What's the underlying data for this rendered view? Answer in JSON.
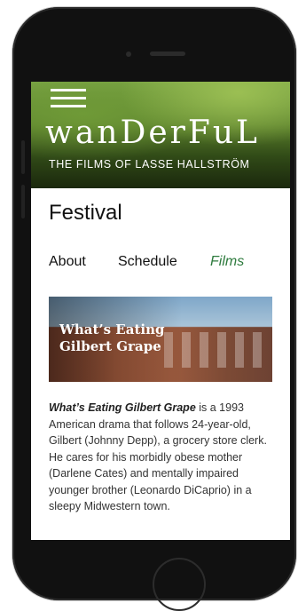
{
  "hero": {
    "logo_text": "wanDerFuL",
    "tagline": "THE FILMS OF LASSE HALLSTRÖM"
  },
  "page": {
    "title": "Festival"
  },
  "nav": {
    "items": [
      {
        "label": "About"
      },
      {
        "label": "Schedule"
      },
      {
        "label": "Films"
      }
    ],
    "active": "Films"
  },
  "film": {
    "card_title_line1": "What’s Eating",
    "card_title_line2": "Gilbert Grape",
    "desc_title": "What’s Eating Gilbert Grape",
    "desc_body": " is a 1993 American drama that follows 24-year-old, Gilbert (Johnny Depp), a grocery store clerk. He cares for his morbidly obese mother (Darlene Cates) and mentally impaired younger brother (Leonardo DiCaprio) in a sleepy Midwestern town."
  },
  "colors": {
    "accent": "#2e7b3e"
  }
}
